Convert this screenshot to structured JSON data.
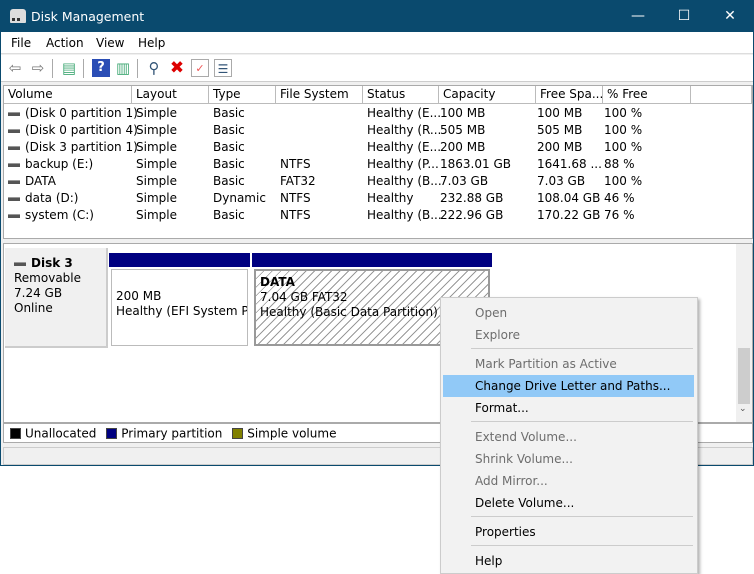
{
  "window": {
    "title": "Disk Management",
    "controls": [
      "—",
      "☐",
      "✕"
    ]
  },
  "menu_bar": [
    "File",
    "Action",
    "View",
    "Help"
  ],
  "toolbar": [
    {
      "icon": "back-icon",
      "glyph": "⇦"
    },
    {
      "icon": "forward-icon",
      "glyph": "⇨"
    },
    {
      "icon": "show-hide-console-tree-icon",
      "glyph": "▤"
    },
    {
      "icon": "help-icon",
      "glyph": "?"
    },
    {
      "icon": "show-hide-action-pane-icon",
      "glyph": "▥"
    },
    {
      "icon": "connect-disk-icon",
      "glyph": "⚲"
    },
    {
      "icon": "delete-icon",
      "glyph": "✖"
    },
    {
      "icon": "properties-icon",
      "glyph": "✓"
    },
    {
      "icon": "checklist-icon",
      "glyph": "☰"
    }
  ],
  "volume_list": {
    "columns": [
      "Volume",
      "Layout",
      "Type",
      "File System",
      "Status",
      "Capacity",
      "Free Spa...",
      "% Free",
      ""
    ],
    "rows": [
      [
        "(Disk 0 partition 1)",
        "Simple",
        "Basic",
        "",
        "Healthy (E...",
        "100 MB",
        "100 MB",
        "100 %"
      ],
      [
        "(Disk 0 partition 4)",
        "Simple",
        "Basic",
        "",
        "Healthy (R...",
        "505 MB",
        "505 MB",
        "100 %"
      ],
      [
        "(Disk 3 partition 1)",
        "Simple",
        "Basic",
        "",
        "Healthy (E...",
        "200 MB",
        "200 MB",
        "100 %"
      ],
      [
        "backup (E:)",
        "Simple",
        "Basic",
        "NTFS",
        "Healthy (P...",
        "1863.01 GB",
        "1641.68 ...",
        "88 %"
      ],
      [
        "DATA",
        "Simple",
        "Basic",
        "FAT32",
        "Healthy (B...",
        "7.03 GB",
        "7.03 GB",
        "100 %"
      ],
      [
        "data (D:)",
        "Simple",
        "Dynamic",
        "NTFS",
        "Healthy",
        "232.88 GB",
        "108.04 GB",
        "46 %"
      ],
      [
        "system (C:)",
        "Simple",
        "Basic",
        "NTFS",
        "Healthy (B...",
        "222.96 GB",
        "170.22 GB",
        "76 %"
      ]
    ]
  },
  "disk": {
    "name": "Disk 3",
    "type": "Removable",
    "size": "7.24 GB",
    "state": "Online",
    "partitions": [
      {
        "name": "",
        "size": "200 MB",
        "status": "Healthy (EFI System Part"
      },
      {
        "name": "DATA",
        "size": "7.04 GB FAT32",
        "status": "Healthy (Basic Data Partition)"
      }
    ]
  },
  "legend": [
    {
      "label": "Unallocated",
      "color": "#000000"
    },
    {
      "label": "Primary partition",
      "color": "#000080"
    },
    {
      "label": "Simple volume",
      "color": "#808000"
    }
  ],
  "context_menu": [
    {
      "label": "Open",
      "disabled": true
    },
    {
      "label": "Explore",
      "disabled": true
    },
    {
      "sep": true
    },
    {
      "label": "Mark Partition as Active",
      "disabled": true
    },
    {
      "label": "Change Drive Letter and Paths...",
      "highlighted": true
    },
    {
      "label": "Format..."
    },
    {
      "sep": true
    },
    {
      "label": "Extend Volume...",
      "disabled": true
    },
    {
      "label": "Shrink Volume...",
      "disabled": true
    },
    {
      "label": "Add Mirror...",
      "disabled": true
    },
    {
      "label": "Delete Volume..."
    },
    {
      "sep": true
    },
    {
      "label": "Properties"
    },
    {
      "sep": true
    },
    {
      "label": "Help"
    }
  ]
}
